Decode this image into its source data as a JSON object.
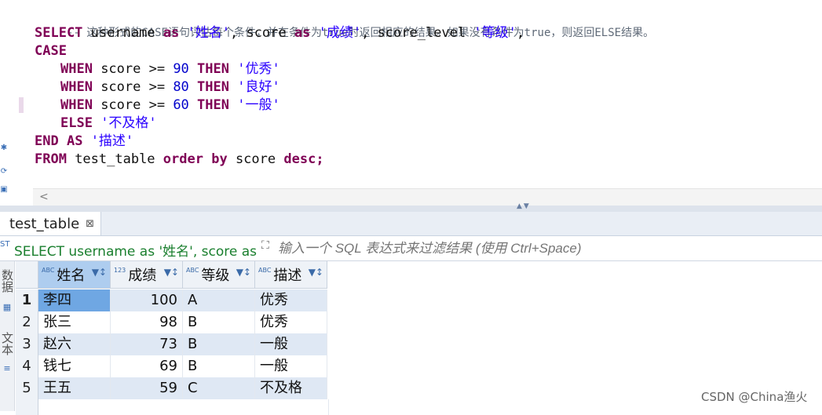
{
  "editor": {
    "comment": "-- 这种形式的CASE语句评估每个条件，并在条件为true时返回相应的结果。如果没有条件为true，则返回ELSE结果。",
    "sql": {
      "l1_select": "SELECT",
      "l1_a": " username ",
      "l1_as1": "as",
      "l1_s1": " '姓名'",
      "l1_b": ", score ",
      "l1_as2": "as",
      "l1_s2": " '成绩'",
      "l1_c": ", score_level ",
      "l1_s3": "'等级'",
      "l1_d": ",",
      "case": "CASE",
      "when": "WHEN",
      "then": "THEN",
      "score_ge": " score >= ",
      "w1_num": "90",
      "w1_str": "'优秀'",
      "w2_num": "80",
      "w2_str": "'良好'",
      "w3_num": "60",
      "w3_str": "'一般'",
      "else": "ELSE",
      "else_str": " '不及格'",
      "end": "END",
      "as_end": "AS",
      "end_str": " '描述'",
      "from": "FROM",
      "from_tbl": " test_table ",
      "order": "order",
      "by": "by",
      "order_col": " score ",
      "desc": "desc",
      "semi": ";"
    }
  },
  "results": {
    "tab_label": "test_table",
    "filter_query": "SELECT username as '姓名', score as",
    "filter_placeholder": "输入一个 SQL 表达式来过滤结果 (使用 Ctrl+Space)",
    "columns": [
      {
        "name": "姓名",
        "type": "ABC"
      },
      {
        "name": "成绩",
        "type": "123"
      },
      {
        "name": "等级",
        "type": "ABC"
      },
      {
        "name": "描述",
        "type": "ABC"
      }
    ],
    "rows": [
      {
        "n": "1",
        "name": "李四",
        "score": "100",
        "level": "A",
        "desc": "优秀"
      },
      {
        "n": "2",
        "name": "张三",
        "score": "98",
        "level": "B",
        "desc": "优秀"
      },
      {
        "n": "3",
        "name": "赵六",
        "score": "73",
        "level": "B",
        "desc": "一般"
      },
      {
        "n": "4",
        "name": "钱七",
        "score": "69",
        "level": "B",
        "desc": "一般"
      },
      {
        "n": "5",
        "name": "王五",
        "score": "59",
        "level": "C",
        "desc": "不及格"
      }
    ],
    "side_labels": [
      "数据",
      "文本"
    ]
  },
  "watermark": "CSDN @China渔火",
  "colors": {
    "keyword": "#7f0055",
    "string": "#2a00ff",
    "number": "#0000cc",
    "selection": "#6fa7e3"
  }
}
